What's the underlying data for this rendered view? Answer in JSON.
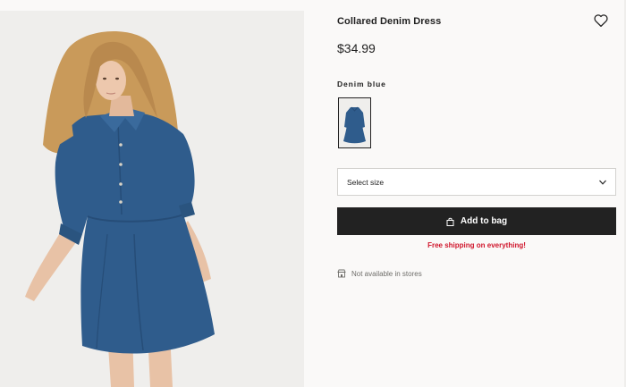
{
  "product": {
    "title": "Collared Denim Dress",
    "price": "$34.99",
    "color_name": "Denim blue",
    "size_select_label": "Select size",
    "add_to_bag_label": "Add to bag",
    "shipping_note": "Free shipping on everything!",
    "store_availability": "Not available in stores"
  },
  "icons": {
    "favorite": "heart-icon",
    "size_dropdown": "chevron-down-icon",
    "add_to_bag": "shopping-bag-icon",
    "store": "store-icon"
  },
  "colors": {
    "accent_dark": "#222222",
    "shipping_red": "#d0152b",
    "denim": "#2f5c8c",
    "background": "#faf9f8"
  }
}
